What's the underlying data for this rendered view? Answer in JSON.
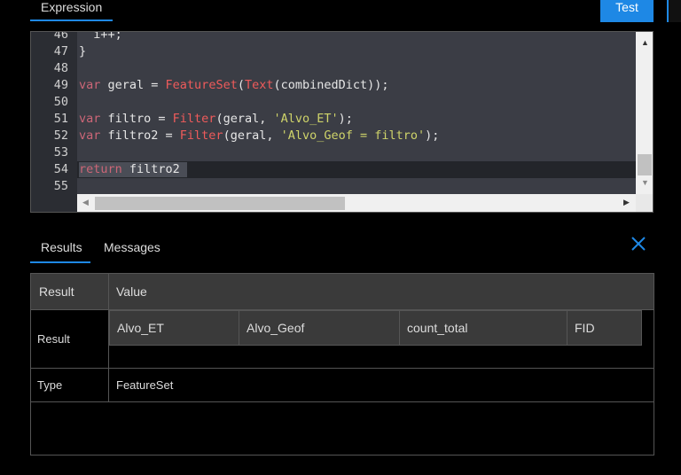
{
  "tabs": {
    "expression": "Expression",
    "test": "Test"
  },
  "editor": {
    "line_numbers": [
      "46",
      "47",
      "48",
      "49",
      "50",
      "51",
      "52",
      "53",
      "54",
      "55"
    ]
  },
  "result_tabs": {
    "results": "Results",
    "messages": "Messages"
  },
  "results_table": {
    "headers": {
      "result": "Result",
      "value": "Value"
    },
    "rows": {
      "result_label": "Result",
      "type_label": "Type",
      "type_value": "FeatureSet"
    },
    "columns": [
      "Alvo_ET",
      "Alvo_Geof",
      "count_total",
      "FID"
    ]
  },
  "colors": {
    "accent": "#1e88e5",
    "editor_bg": "#3b3d45",
    "header_bg": "#3a3a3a"
  }
}
